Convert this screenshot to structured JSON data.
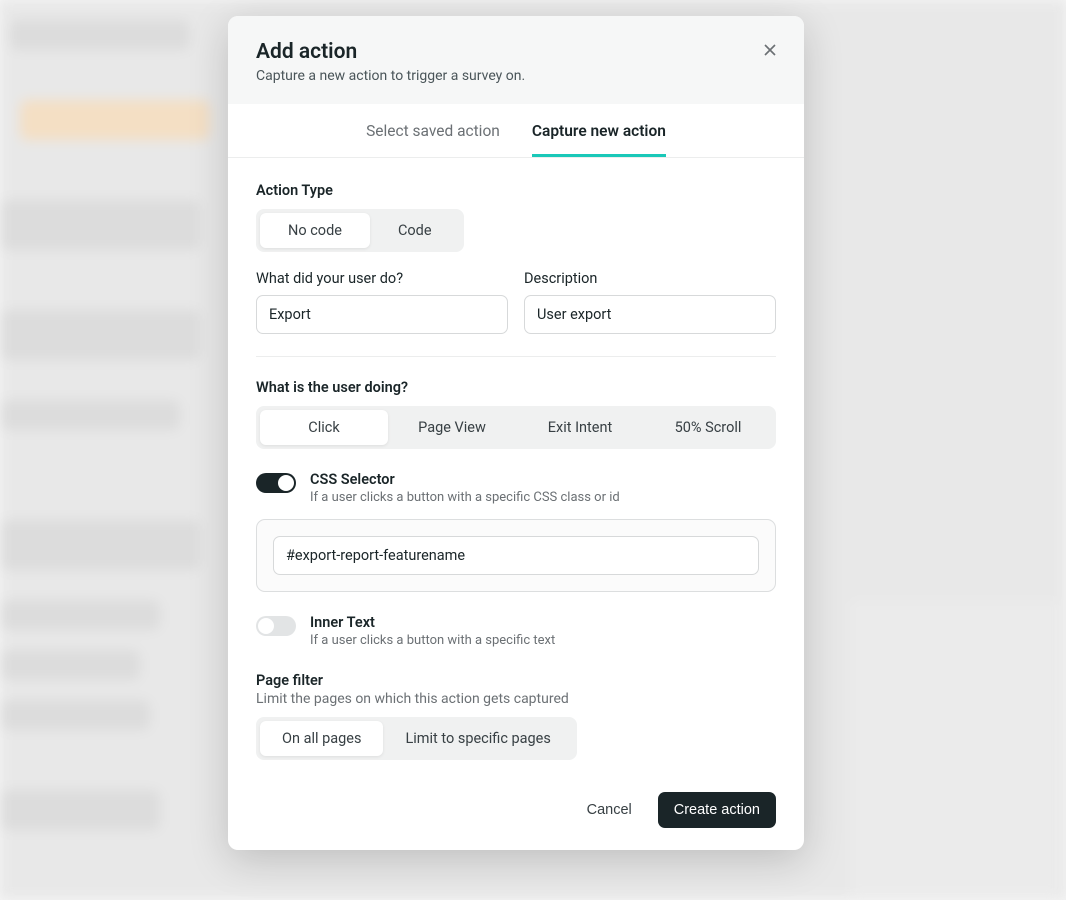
{
  "modal": {
    "title": "Add action",
    "subtitle": "Capture a new action to trigger a survey on."
  },
  "tabs": {
    "saved": "Select saved action",
    "capture": "Capture new action"
  },
  "actionType": {
    "label": "Action Type",
    "noCode": "No code",
    "code": "Code"
  },
  "nameField": {
    "label": "What did your user do?",
    "value": "Export"
  },
  "descField": {
    "label": "Description",
    "value": "User export"
  },
  "activity": {
    "label": "What is the user doing?",
    "click": "Click",
    "pageView": "Page View",
    "exitIntent": "Exit Intent",
    "scroll": "50% Scroll"
  },
  "cssSelector": {
    "title": "CSS Selector",
    "sub": "If a user clicks a button with a specific CSS class or id",
    "value": "#export-report-featurename"
  },
  "innerText": {
    "title": "Inner Text",
    "sub": "If a user clicks a button with a specific text"
  },
  "pageFilter": {
    "label": "Page filter",
    "sub": "Limit the pages on which this action gets captured",
    "all": "On all pages",
    "limit": "Limit to specific pages"
  },
  "buttons": {
    "cancel": "Cancel",
    "create": "Create action"
  }
}
